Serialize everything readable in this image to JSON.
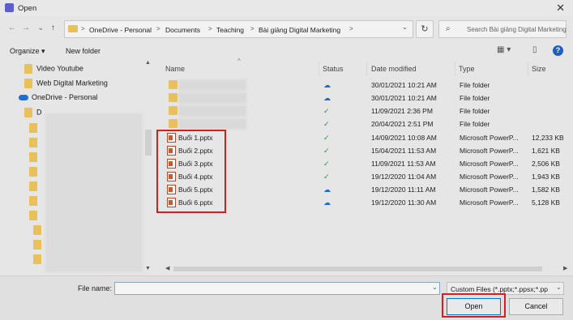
{
  "window": {
    "title": "Open",
    "close_glyph": "✕"
  },
  "nav": {
    "back": "←",
    "forward": "→",
    "dropdown": "⌄",
    "up": "↑"
  },
  "breadcrumb": {
    "items": [
      "OneDrive - Personal",
      "Documents",
      "Teaching",
      "Bài giảng Digital Marketing"
    ],
    "separator": ">"
  },
  "search": {
    "placeholder": "Search Bài giảng Digital Marketing"
  },
  "toolbar": {
    "organize": "Organize ▾",
    "new_folder": "New folder",
    "view_glyph": "▦ ▾",
    "pane_glyph": "▯",
    "help_glyph": "?"
  },
  "sidebar": {
    "items": [
      {
        "label": "Video Youtube",
        "icon": "folder-icon"
      },
      {
        "label": "Web Digital Marketing",
        "icon": "folder-icon"
      },
      {
        "label": "OneDrive - Personal",
        "icon": "onedrive-cloud-icon"
      },
      {
        "label": "D",
        "icon": "folder-icon"
      }
    ]
  },
  "columns": {
    "name": "Name",
    "status": "Status",
    "date": "Date modified",
    "type": "Type",
    "size": "Size"
  },
  "files": [
    {
      "name": "",
      "status": "cloud",
      "date": "30/01/2021 10:21 AM",
      "type": "File folder",
      "size": "",
      "kind": "folder"
    },
    {
      "name": "",
      "status": "cloud",
      "date": "30/01/2021 10:21 AM",
      "type": "File folder",
      "size": "",
      "kind": "folder"
    },
    {
      "name": "",
      "status": "check",
      "date": "11/09/2021 2:36 PM",
      "type": "File folder",
      "size": "",
      "kind": "folder"
    },
    {
      "name": "",
      "status": "check",
      "date": "20/04/2021 2:51 PM",
      "type": "File folder",
      "size": "",
      "kind": "folder"
    },
    {
      "name": "Buổi 1.pptx",
      "status": "check",
      "date": "14/09/2021 10:08 AM",
      "type": "Microsoft PowerP...",
      "size": "12,233 KB",
      "kind": "pptx"
    },
    {
      "name": "Buổi 2.pptx",
      "status": "check",
      "date": "15/04/2021 11:53 AM",
      "type": "Microsoft PowerP...",
      "size": "1,621 KB",
      "kind": "pptx"
    },
    {
      "name": "Buổi 3.pptx",
      "status": "check",
      "date": "11/09/2021 11:53 AM",
      "type": "Microsoft PowerP...",
      "size": "2,506 KB",
      "kind": "pptx"
    },
    {
      "name": "Buổi 4.pptx",
      "status": "check",
      "date": "19/12/2020 11:04 AM",
      "type": "Microsoft PowerP...",
      "size": "1,943 KB",
      "kind": "pptx"
    },
    {
      "name": "Buổi 5.pptx",
      "status": "cloud",
      "date": "19/12/2020 11:11 AM",
      "type": "Microsoft PowerP...",
      "size": "1,582 KB",
      "kind": "pptx"
    },
    {
      "name": "Buổi 6.pptx",
      "status": "cloud",
      "date": "19/12/2020 11:30 AM",
      "type": "Microsoft PowerP...",
      "size": "5,128 KB",
      "kind": "pptx"
    }
  ],
  "footer": {
    "file_name_label": "File name:",
    "file_name_value": "",
    "file_type": "Custom Files (*.pptx;*.ppsx;*.pp",
    "open_label": "Open",
    "cancel_label": "Cancel"
  },
  "colors": {
    "highlight": "#d41f1f",
    "accent": "#0078d7",
    "folder": "#e8c15a"
  }
}
